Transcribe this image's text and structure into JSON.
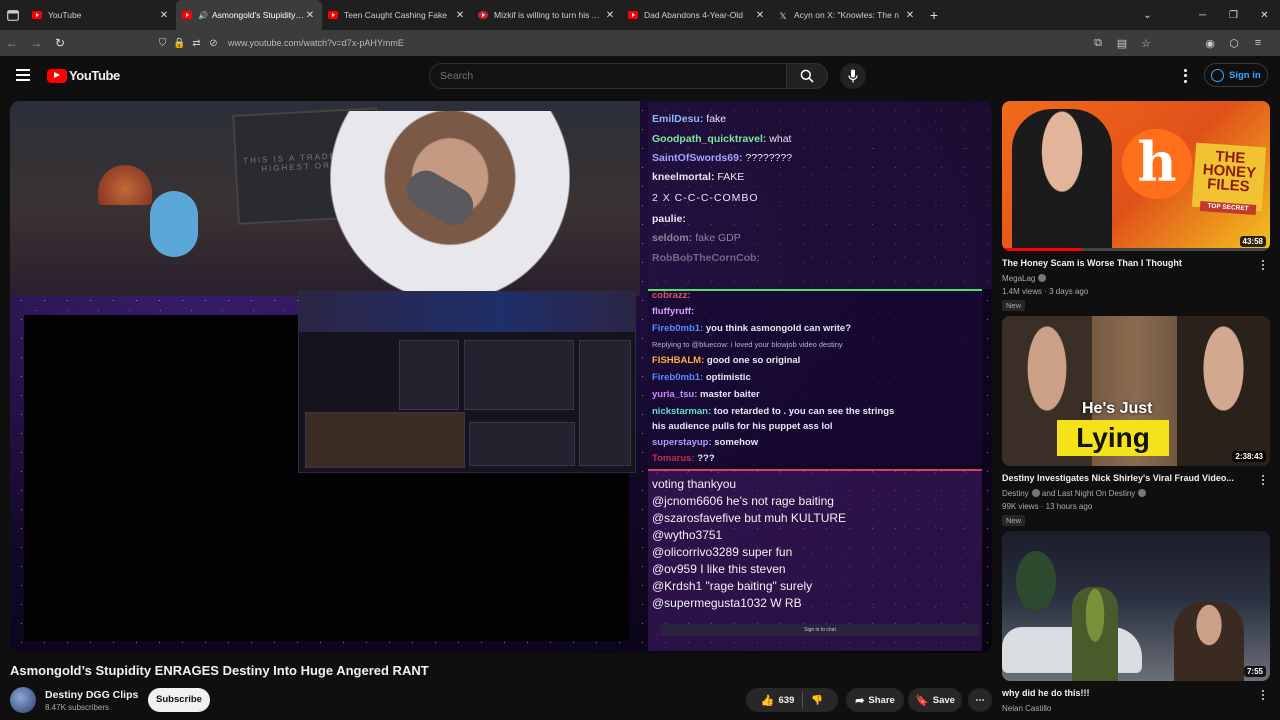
{
  "browser": {
    "tabs": [
      {
        "title": "YouTube",
        "icon": "youtube-favicon",
        "active": false
      },
      {
        "title": "Asmongold's Stupidity ENR",
        "icon": "youtube-favicon",
        "active": true
      },
      {
        "title": "Teen Caught Cashing Fake",
        "icon": "youtube-favicon",
        "active": false
      },
      {
        "title": "Mizkif is willing to turn his Aust",
        "icon": "site-favicon",
        "active": false
      },
      {
        "title": "Dad Abandons 4-Year-Old",
        "icon": "youtube-favicon",
        "active": false
      },
      {
        "title": "Acyn on X: \"Knowles: The n",
        "icon": "x-favicon",
        "active": false
      }
    ],
    "url": "www.youtube.com/watch?v=d7x-pAHYmmE"
  },
  "header": {
    "logo_text": "YouTube",
    "search_placeholder": "Search",
    "signin_label": "Sign in"
  },
  "video": {
    "title": "Asmongold’s Stupidity ENRAGES Destiny Into Huge Angered RANT",
    "wall_sign": "THIS IS A TRADER THE HIGHEST ORDER",
    "channel_name": "Destiny DGG Clips",
    "subscribers": "8.47K subscribers",
    "subscribe_label": "Subscribe",
    "likes": "639",
    "share_label": "Share",
    "save_label": "Save",
    "chat_top": [
      {
        "user": "EmilDesu:",
        "msg": "fake",
        "color": "#8fb7ff"
      },
      {
        "user": "Goodpath_quicktravel:",
        "msg": "what",
        "color": "#7fe3a0"
      },
      {
        "user": "SaintOfSwords69:",
        "msg": "????????",
        "color": "#9ea8ff"
      },
      {
        "user": "kneelmortal:",
        "msg": "FAKE",
        "color": "#e9e6f5"
      },
      {
        "user": "",
        "msg": "2 X C-C-C-COMBO",
        "color": "#e9e6f5"
      },
      {
        "user": "paulie:",
        "msg": "",
        "color": "#e9e6f5"
      },
      {
        "user": "seldom:",
        "msg": "fake GDP",
        "color": "#8a86a0"
      },
      {
        "user": "RobBobTheCornCob:",
        "msg": "",
        "color": "#6e6a86"
      }
    ],
    "chat_mid": [
      {
        "user": "cobrazz:",
        "msg": "",
        "color": "#e0506a"
      },
      {
        "user": "fluffyruff:",
        "msg": "",
        "color": "#d8a0ff"
      },
      {
        "user": "Fireb0mb1:",
        "msg": "you think asmongold can write?",
        "color": "#5a8cff"
      },
      {
        "user": "",
        "msg": "Replying to @bluecow: i loved your blowjob video destiny",
        "color": "#b8b4cc"
      },
      {
        "user": "FISHBALM:",
        "msg": "good one so original",
        "color": "#ffb03a"
      },
      {
        "user": "Fireb0mb1:",
        "msg": "optimistic",
        "color": "#5a8cff"
      },
      {
        "user": "yuria_tsu:",
        "msg": "master baiter",
        "color": "#c98cff"
      },
      {
        "user": "nickstarman:",
        "msg": "too retarded to . you can see the strings",
        "color": "#5fe0c8"
      },
      {
        "user": "",
        "msg": "his audience pulls for his puppet ass lol",
        "color": "#e9e6f5"
      },
      {
        "user": "superstayup:",
        "msg": "somehow",
        "color": "#a8a0ff"
      },
      {
        "user": "Tomarus:",
        "msg": "???",
        "color": "#c0304a"
      }
    ],
    "chat_bottom": [
      "voting thankyou",
      "@jcnom6606 he's not rage baiting",
      "@szarosfavefive but muh KULTURE",
      "@wytho3751",
      "@olicorrivo3289 super fun",
      "@ov959 I like this steven",
      "@Krdsh1 \"rage baiting\" surely",
      "@supermegusta1032 W RB"
    ],
    "chat_signin": "Sign in to chat"
  },
  "recommendations": [
    {
      "title": "The Honey Scam is Worse Than I Thought",
      "channel": "MegaLag",
      "meta": "1.4M views · 3 days ago",
      "badge": "New",
      "duration": "43:58",
      "thumb_text": "THE HONEY FILES",
      "thumb_sub": "TOP SECRET"
    },
    {
      "title": "Destiny Investigates Nick Shirley's Viral Fraud Video...",
      "channel": "Destiny",
      "channel_extra": "and Last Night On Destiny",
      "meta": "99K views · 13 hours ago",
      "badge": "New",
      "duration": "2:38:43",
      "thumb_text": "He's Just",
      "thumb_sub": "Lying"
    },
    {
      "title": "why did he do this!!!",
      "channel": "Nelan Castillo",
      "duration": "7:55"
    }
  ]
}
